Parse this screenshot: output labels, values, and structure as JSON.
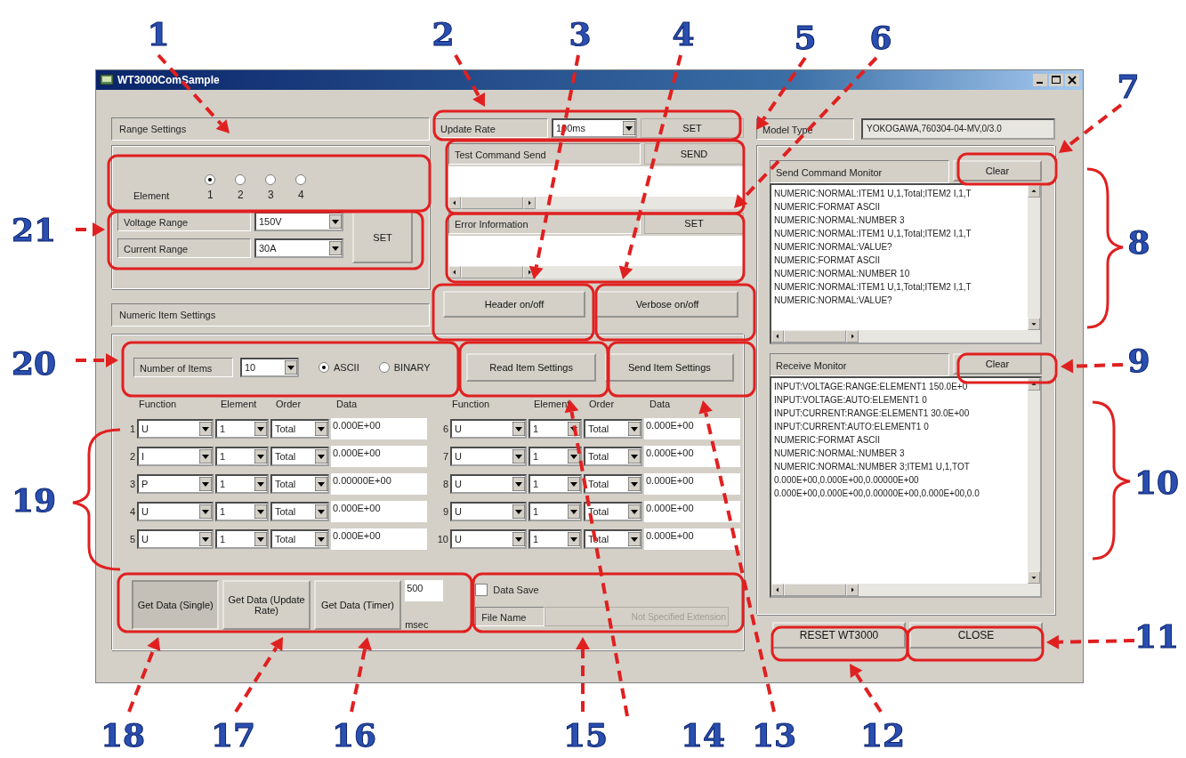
{
  "callouts": [
    "1",
    "2",
    "3",
    "4",
    "5",
    "6",
    "7",
    "21",
    "8",
    "20",
    "9",
    "19",
    "10",
    "11",
    "18",
    "17",
    "16",
    "15",
    "14",
    "13",
    "12"
  ],
  "window": {
    "title": "WT3000ComSample"
  },
  "range_settings": {
    "header": "Range Settings",
    "element_label": "Element",
    "elements": [
      {
        "label": "1",
        "selected": true
      },
      {
        "label": "2",
        "selected": false
      },
      {
        "label": "3",
        "selected": false
      },
      {
        "label": "4",
        "selected": false
      }
    ],
    "voltage_label": "Voltage Range",
    "voltage_value": "150V",
    "current_label": "Current Range",
    "current_value": "30A",
    "set_button": "SET"
  },
  "update_rate": {
    "label": "Update Rate",
    "value": "100ms",
    "button": "SET"
  },
  "test_command": {
    "label": "Test Command Send",
    "button": "SEND"
  },
  "error_information": {
    "label": "Error Information",
    "button": "SET"
  },
  "header_button": "Header on/off",
  "verbose_button": "Verbose on/off",
  "numeric_settings": {
    "header": "Numeric Item Settings",
    "items_label": "Number of Items",
    "items_value": "10",
    "formats": [
      {
        "label": "ASCII",
        "selected": true
      },
      {
        "label": "BINARY",
        "selected": false
      }
    ],
    "read_button": "Read Item Settings",
    "send_button": "Send Item Settings",
    "columns": [
      [
        "Function",
        "Element",
        "Order",
        "Data"
      ],
      [
        "Function",
        "Element",
        "Order",
        "Data"
      ]
    ],
    "rows": [
      {
        "index": "1",
        "function": "U",
        "element": "1",
        "order": "Total",
        "data": "0.000E+00"
      },
      {
        "index": "2",
        "function": "I",
        "element": "1",
        "order": "Total",
        "data": "0.000E+00"
      },
      {
        "index": "3",
        "function": "P",
        "element": "1",
        "order": "Total",
        "data": "0.00000E+00"
      },
      {
        "index": "4",
        "function": "U",
        "element": "1",
        "order": "Total",
        "data": "0.000E+00"
      },
      {
        "index": "5",
        "function": "U",
        "element": "1",
        "order": "Total",
        "data": "0.000E+00"
      },
      {
        "index": "6",
        "function": "U",
        "element": "1",
        "order": "Total",
        "data": "0.000E+00"
      },
      {
        "index": "7",
        "function": "U",
        "element": "1",
        "order": "Total",
        "data": "0.000E+00"
      },
      {
        "index": "8",
        "function": "U",
        "element": "1",
        "order": "Total",
        "data": "0.000E+00"
      },
      {
        "index": "9",
        "function": "U",
        "element": "1",
        "order": "Total",
        "data": "0.000E+00"
      },
      {
        "index": "10",
        "function": "U",
        "element": "1",
        "order": "Total",
        "data": "0.000E+00"
      }
    ]
  },
  "get_data": [
    {
      "label": "Get Data (Single)",
      "selected": true
    },
    {
      "label": "Get Data (Update Rate)",
      "selected": false
    },
    {
      "label": "Get Data (Timer)",
      "selected": false
    }
  ],
  "timer": {
    "value": "500",
    "unit": "msec"
  },
  "data_save": {
    "label": "Data Save",
    "checked": false,
    "file_name_label": "File Name",
    "placeholder": "Not Specified Extension"
  },
  "model_type": {
    "label": "Model Type",
    "value": "YOKOGAWA,760304-04-MV,0/3.0"
  },
  "send_monitor": {
    "label": "Send Command Monitor",
    "button": "Clear",
    "lines": [
      "NUMERIC:NORMAL:ITEM1 U,1,Total;ITEM2 I,1,T",
      "NUMERIC:FORMAT ASCII",
      "NUMERIC:NORMAL:NUMBER 3",
      "NUMERIC:NORMAL:ITEM1 U,1,Total;ITEM2 I,1,T",
      "NUMERIC:NORMAL:VALUE?",
      "NUMERIC:FORMAT ASCII",
      "NUMERIC:NORMAL:NUMBER 10",
      "NUMERIC:NORMAL:ITEM1 U,1,Total;ITEM2 I,1,T",
      "NUMERIC:NORMAL:VALUE?"
    ]
  },
  "receive_monitor": {
    "label": "Receive Monitor",
    "button": "Clear",
    "lines": [
      "INPUT:VOLTAGE:RANGE:ELEMENT1 150.0E+0",
      "INPUT:VOLTAGE:AUTO:ELEMENT1 0",
      "INPUT:CURRENT:RANGE:ELEMENT1 30.0E+00",
      "INPUT:CURRENT:AUTO:ELEMENT1 0",
      "NUMERIC:FORMAT ASCII",
      "NUMERIC:NORMAL:NUMBER 3",
      "NUMERIC:NORMAL:NUMBER 3;ITEM1 U,1,TOT",
      "0.000E+00,0.000E+00,0.00000E+00",
      "0.000E+00,0.000E+00,0.00000E+00,0.000E+00,0.0"
    ]
  },
  "reset_button": "RESET WT3000",
  "close_button": "CLOSE"
}
